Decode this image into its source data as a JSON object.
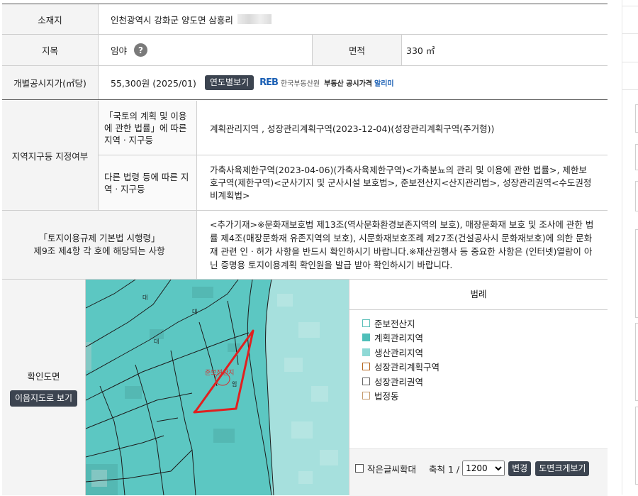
{
  "location": {
    "label": "소재지",
    "value": "인천광역시 강화군 양도면 삼흥리"
  },
  "land": {
    "category_label": "지목",
    "category_value": "임야",
    "help_icon": "?",
    "area_label": "면적",
    "area_value": "330 ㎡"
  },
  "price": {
    "label": "개별공시지가(㎡당)",
    "value": "55,300원 (2025/01)",
    "yearly_button": "연도별보기",
    "reb_logo": "REB",
    "reb_org": "한국부동산원",
    "reb_service": "부동산 공시가격",
    "reb_service_highlight": "알리미"
  },
  "zoning": {
    "label": "지역지구등 지정여부",
    "national_label": "「국토의 계획 및 이용에 관한 법률」에 따른 지역ㆍ지구등",
    "national_value": "계획관리지역 , 성장관리계획구역(2023-12-04)(성장관리계획구역(주거형))",
    "other_label": "다른 법령 등에 따른 지역ㆍ지구등",
    "other_value": "가축사육제한구역(2023-04-06)(가축사육제한구역)<가축분뇨의 관리 및 이용에 관한 법률>, 제한보호구역(제한구역)<군사기지 및 군사시설 보호법>, 준보전산지<산지관리법>, 성장관리권역<수도권정비계획법>"
  },
  "regulation": {
    "label_line1": "「토지이용규제 기본법 시행령」",
    "label_line2": "제9조 제4항 각 호에 해당되는 사항",
    "value": "<추가기재>※문화재보호법 제13조(역사문화환경보존지역의 보호), 매장문화재 보호 및 조사에 관한 법률 제4조(매장문화재 유존지역의 보호), 시문화재보호조례 제27조(건설공사시 문화재보호)에 의한 문화재 관련 인ㆍ허가 사항을 반드시 확인하시기 바랍니다.※재산권행사 등 중요한 사항은 (인터넷)열람이 아닌 증명용 토지이용계획 확인원을 발급 받아 확인하시기 바랍니다."
  },
  "map": {
    "label": "확인도면",
    "view_button": "이음지도로 보기",
    "parcel_label": "준보전산지",
    "legend_title": "범례",
    "legend": [
      {
        "label": "준보전산지",
        "fill": "#ffffff",
        "border": "#5bbfb9"
      },
      {
        "label": "계획관리지역",
        "fill": "#4fbfb9",
        "border": "#4fbfb9"
      },
      {
        "label": "생산관리지역",
        "fill": "#8fd9d6",
        "border": "#8fd9d6"
      },
      {
        "label": "성장관리계획구역",
        "fill": "#ffffff",
        "border": "#b5651d"
      },
      {
        "label": "성장관리권역",
        "fill": "#ffffff",
        "border": "#666666"
      },
      {
        "label": "법정동",
        "fill": "#ffffff",
        "border": "#c49a6c"
      }
    ],
    "small_text_checkbox": "작은글씨확대",
    "scale_label": "축척 1 /",
    "scale_value": "1200",
    "change_button": "변경",
    "enlarge_button": "도면크게보기"
  }
}
